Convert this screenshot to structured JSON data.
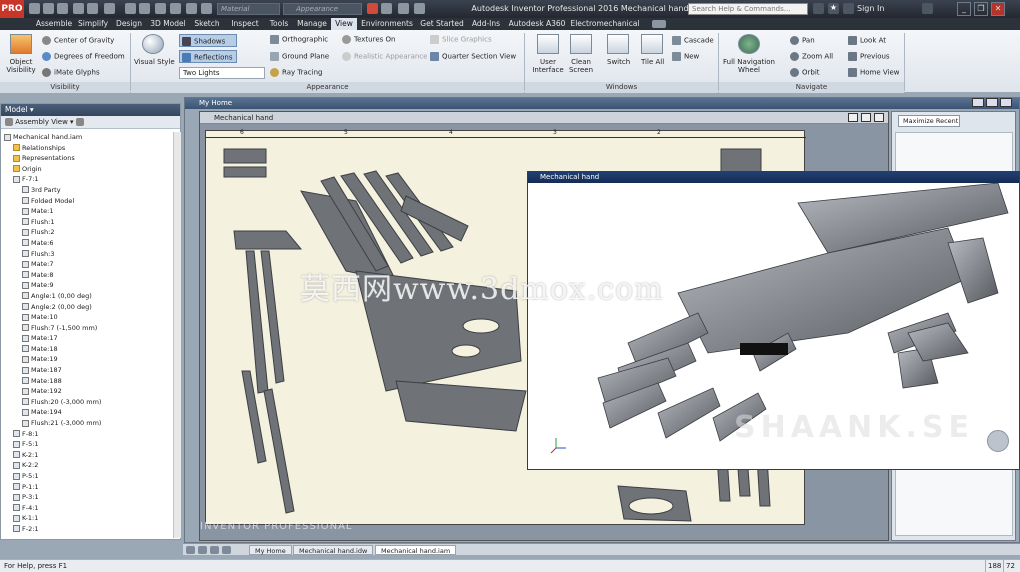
{
  "app": {
    "logo": "PRO",
    "material_placeholder": "Material",
    "appearance_placeholder": "Appearance",
    "title": "Autodesk Inventor Professional 2016   Mechanical hand",
    "search_placeholder": "Search Help & Commands...",
    "sign_in": "Sign In"
  },
  "tabs": [
    "Assemble",
    "Simplify",
    "Design",
    "3D Model",
    "Sketch",
    "Inspect",
    "Tools",
    "Manage",
    "View",
    "Environments",
    "Get Started",
    "Add-Ins",
    "Autodesk A360",
    "Electromechanical"
  ],
  "active_tab": "View",
  "ribbon": {
    "visibility": {
      "object_visibility": "Object Visibility",
      "center_of_gravity": "Center of Gravity",
      "degrees_of_freedom": "Degrees of Freedom",
      "imate_glyphs": "iMate Glyphs",
      "label": "Visibility"
    },
    "appearance": {
      "visual_style": "Visual Style",
      "shadows": "Shadows",
      "reflections": "Reflections",
      "lighting": "Two Lights",
      "orthographic": "Orthographic",
      "ground_plane": "Ground Plane",
      "ray_tracing": "Ray Tracing",
      "textures_on": "Textures On",
      "realistic_appearance": "Realistic Appearance",
      "slice_graphics": "Slice Graphics",
      "quarter_section": "Quarter Section View",
      "label": "Appearance"
    },
    "windows": {
      "user_interface": "User Interface",
      "clean_screen": "Clean Screen",
      "switch": "Switch",
      "tile_all": "Tile All",
      "cascade": "Cascade",
      "new": "New",
      "label": "Windows"
    },
    "navigate": {
      "full_navigation_wheel": "Full Navigation Wheel",
      "pan": "Pan",
      "zoom_all": "Zoom All",
      "orbit": "Orbit",
      "look_at": "Look At",
      "previous": "Previous",
      "home_view": "Home View",
      "label": "Navigate"
    }
  },
  "browser": {
    "title": "Model",
    "view": "Assembly View",
    "items": [
      {
        "label": "Mechanical hand.iam",
        "indent": 0,
        "folder": false
      },
      {
        "label": "Relationships",
        "indent": 1,
        "folder": true
      },
      {
        "label": "Representations",
        "indent": 1,
        "folder": true
      },
      {
        "label": "Origin",
        "indent": 1,
        "folder": true
      },
      {
        "label": "F-7:1",
        "indent": 1,
        "folder": false
      },
      {
        "label": "3rd Party",
        "indent": 2,
        "folder": false
      },
      {
        "label": "Folded Model",
        "indent": 2,
        "folder": false
      },
      {
        "label": "Mate:1",
        "indent": 2,
        "folder": false
      },
      {
        "label": "Flush:1",
        "indent": 2,
        "folder": false
      },
      {
        "label": "Flush:2",
        "indent": 2,
        "folder": false
      },
      {
        "label": "Mate:6",
        "indent": 2,
        "folder": false
      },
      {
        "label": "Flush:3",
        "indent": 2,
        "folder": false
      },
      {
        "label": "Mate:7",
        "indent": 2,
        "folder": false
      },
      {
        "label": "Mate:8",
        "indent": 2,
        "folder": false
      },
      {
        "label": "Mate:9",
        "indent": 2,
        "folder": false
      },
      {
        "label": "Angle:1 (0,00 deg)",
        "indent": 2,
        "folder": false
      },
      {
        "label": "Angle:2 (0,00 deg)",
        "indent": 2,
        "folder": false
      },
      {
        "label": "Mate:10",
        "indent": 2,
        "folder": false
      },
      {
        "label": "Flush:7 (-1,500 mm)",
        "indent": 2,
        "folder": false
      },
      {
        "label": "Mate:17",
        "indent": 2,
        "folder": false
      },
      {
        "label": "Mate:18",
        "indent": 2,
        "folder": false
      },
      {
        "label": "Mate:19",
        "indent": 2,
        "folder": false
      },
      {
        "label": "Mate:187",
        "indent": 2,
        "folder": false
      },
      {
        "label": "Mate:188",
        "indent": 2,
        "folder": false
      },
      {
        "label": "Mate:192",
        "indent": 2,
        "folder": false
      },
      {
        "label": "Flush:20 (-3,000 mm)",
        "indent": 2,
        "folder": false
      },
      {
        "label": "Mate:194",
        "indent": 2,
        "folder": false
      },
      {
        "label": "Flush:21 (-3,000 mm)",
        "indent": 2,
        "folder": false
      },
      {
        "label": "F-8:1",
        "indent": 1,
        "folder": false
      },
      {
        "label": "F-5:1",
        "indent": 1,
        "folder": false
      },
      {
        "label": "K-2:1",
        "indent": 1,
        "folder": false
      },
      {
        "label": "K-2:2",
        "indent": 1,
        "folder": false
      },
      {
        "label": "P-5:1",
        "indent": 1,
        "folder": false
      },
      {
        "label": "P-1:1",
        "indent": 1,
        "folder": false
      },
      {
        "label": "P-3:1",
        "indent": 1,
        "folder": false
      },
      {
        "label": "F-4:1",
        "indent": 1,
        "folder": false
      },
      {
        "label": "K-1:1",
        "indent": 1,
        "folder": false
      },
      {
        "label": "F-2:1",
        "indent": 1,
        "folder": false
      }
    ]
  },
  "windows": {
    "my_home_title": "My Home",
    "drawing_title": "Mechanical hand",
    "assembly_title": "Mechanical hand",
    "maximize_recent": "Maximize Recent",
    "ruler_numbers": [
      "6",
      "5",
      "4",
      "3",
      "2"
    ]
  },
  "document_tabs": [
    "My Home",
    "Mechanical hand.idw",
    "Mechanical hand.iam"
  ],
  "active_document_tab": "Mechanical hand.iam",
  "watermarks": {
    "cn": "莫西网www.3dmox.com",
    "en": "SHAANK.SE",
    "bottom": "INVENTOR PROFESSIONAL"
  },
  "status": {
    "help": "For Help, press F1",
    "count1": "188",
    "count2": "72"
  },
  "colors": {
    "title_bar": "#2c323a",
    "ribbon": "#e6ebf1",
    "active_window": "#1b3563",
    "drawing_sheet": "#f4f1df",
    "model_gray": "#6f7378"
  }
}
